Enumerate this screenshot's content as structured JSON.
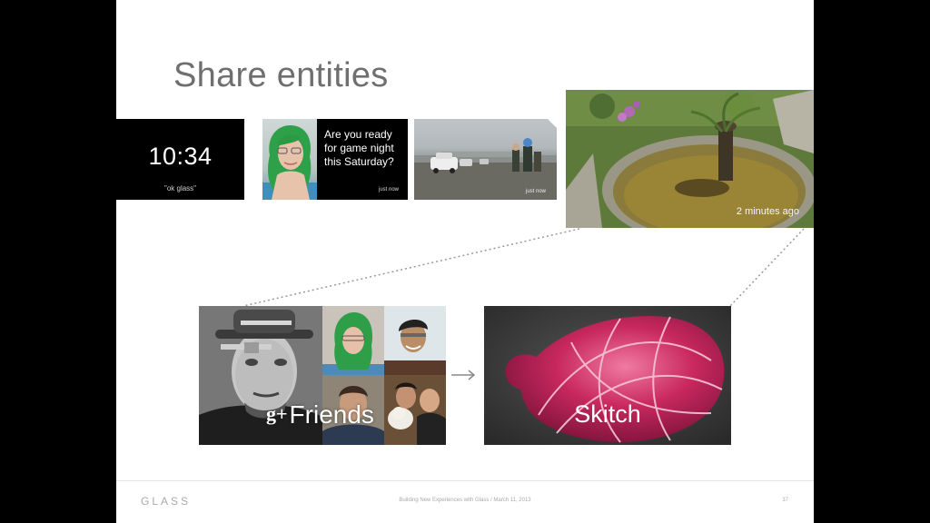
{
  "slide": {
    "title": "Share entities"
  },
  "cards": {
    "clock": {
      "time": "10:34",
      "hint": "\"ok glass\""
    },
    "message": {
      "text": "Are you ready for game night this Saturday?",
      "time": "just now"
    },
    "photo": {
      "time": "just now"
    },
    "plant": {
      "time": "2 minutes ago"
    }
  },
  "share_targets": {
    "friends": {
      "icon": "g+",
      "label": "Friends"
    },
    "skitch": {
      "label": "Skitch"
    }
  },
  "footer": {
    "logo": "GLASS",
    "caption": "Building New Experiences with Glass  /  March 11, 2013",
    "page": "37"
  },
  "colors": {
    "background": "#000000",
    "slide": "#ffffff",
    "title": "#6f6f6f",
    "skitch_pink": "#d2386e"
  }
}
